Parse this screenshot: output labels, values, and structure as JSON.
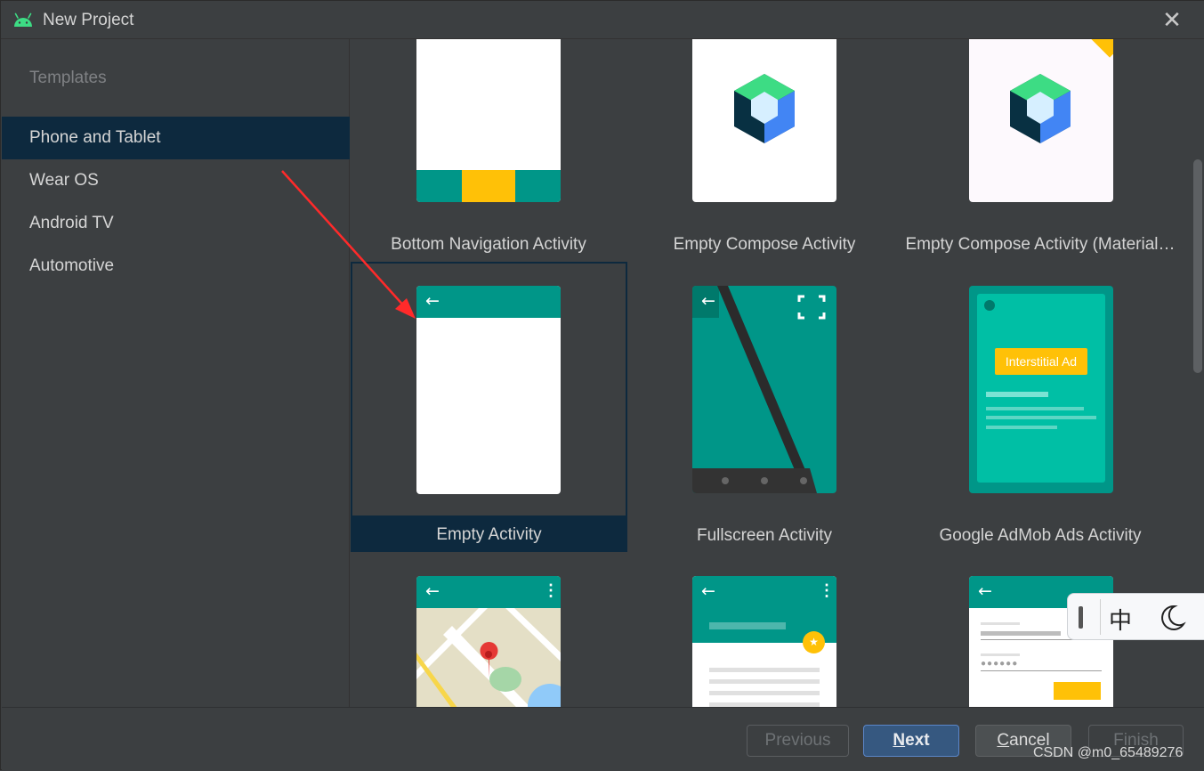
{
  "window": {
    "title": "New Project",
    "close_glyph": "✕"
  },
  "sidebar": {
    "section_label": "Templates",
    "items": [
      {
        "label": "Phone and Tablet",
        "selected": true
      },
      {
        "label": "Wear OS",
        "selected": false
      },
      {
        "label": "Android TV",
        "selected": false
      },
      {
        "label": "Automotive",
        "selected": false
      }
    ]
  },
  "templates": [
    {
      "name": "Bottom Navigation Activity",
      "icon": "bottom-navigation-preview"
    },
    {
      "name": "Empty Compose Activity",
      "icon": "compose-logo"
    },
    {
      "name": "Empty Compose Activity (Material…",
      "icon": "compose-logo"
    },
    {
      "name": "Empty Activity",
      "icon": "empty-activity-preview",
      "selected": true
    },
    {
      "name": "Fullscreen Activity",
      "icon": "fullscreen-activity-preview"
    },
    {
      "name": "Google AdMob Ads Activity",
      "icon": "admob-preview",
      "ad_label": "Interstitial Ad"
    },
    {
      "name": "",
      "icon": "google-maps-preview"
    },
    {
      "name": "",
      "icon": "scrolling-activity-preview"
    },
    {
      "name": "",
      "icon": "login-activity-preview"
    }
  ],
  "footer": {
    "previous": "Previous",
    "next_first": "N",
    "next_rest": "ext",
    "cancel_first": "C",
    "cancel_rest": "ancel",
    "finish": "Finish"
  },
  "ime": {
    "mode_char": "中"
  },
  "watermark": "CSDN @m0_65489276",
  "colors": {
    "accent_teal": "#009688",
    "selection": "#0d293e",
    "amber": "#ffc107",
    "primary_button": "#365880"
  }
}
